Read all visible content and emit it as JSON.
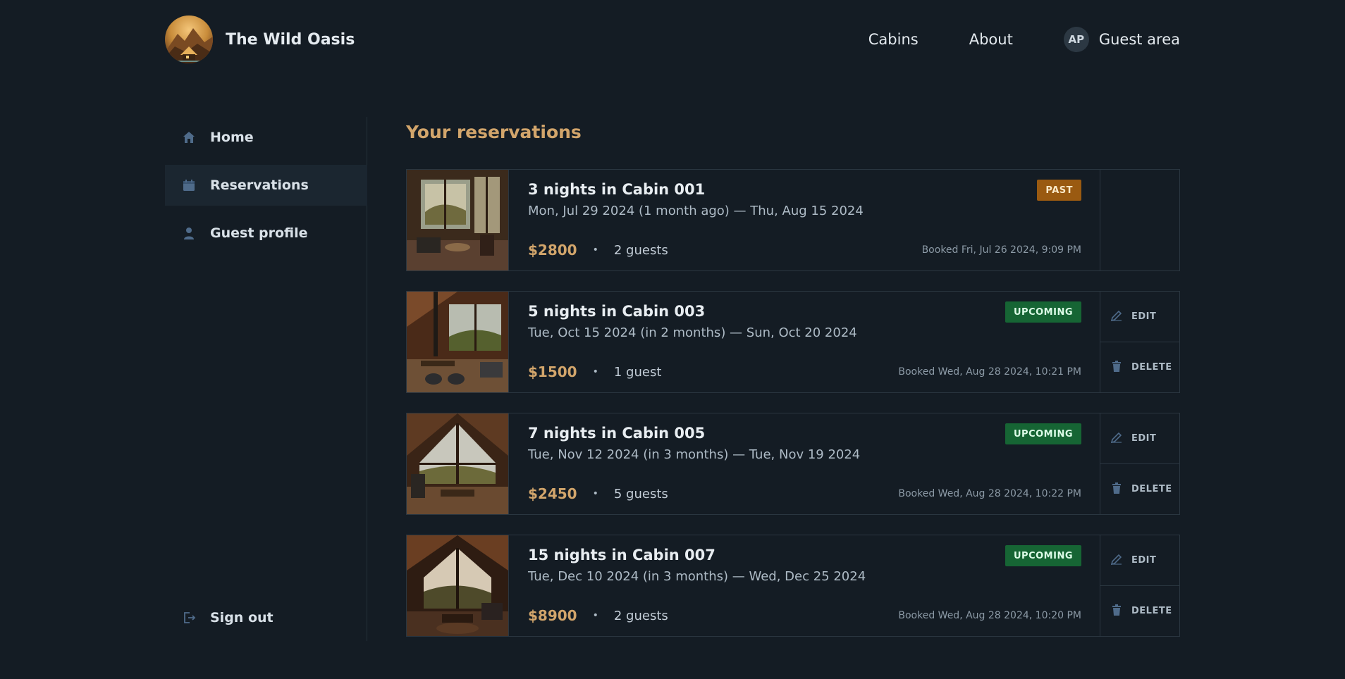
{
  "header": {
    "brand_name": "The Wild Oasis",
    "logo_icon": "mountain-cabin-logo",
    "nav": [
      {
        "label": "Cabins"
      },
      {
        "label": "About"
      }
    ],
    "guest_area": {
      "avatar_initials": "AP",
      "label": "Guest area"
    }
  },
  "sidebar": {
    "items": [
      {
        "label": "Home",
        "icon": "home-icon",
        "active": false
      },
      {
        "label": "Reservations",
        "icon": "calendar-icon",
        "active": true
      },
      {
        "label": "Guest profile",
        "icon": "user-icon",
        "active": false
      }
    ],
    "signout": {
      "label": "Sign out",
      "icon": "sign-out-icon"
    }
  },
  "main": {
    "title": "Your reservations",
    "reservations": [
      {
        "title": "3 nights in Cabin 001",
        "dates": "Mon, Jul 29 2024 (1 month ago) — Thu, Aug 15 2024",
        "price": "$2800",
        "guests": "2 guests",
        "booked": "Booked Fri, Jul 26 2024, 9:09 PM",
        "status": "PAST",
        "actions": []
      },
      {
        "title": "5 nights in Cabin 003",
        "dates": "Tue, Oct 15 2024 (in 2 months) — Sun, Oct 20 2024",
        "price": "$1500",
        "guests": "1 guest",
        "booked": "Booked Wed, Aug 28 2024, 10:21 PM",
        "status": "UPCOMING",
        "actions": [
          "EDIT",
          "DELETE"
        ]
      },
      {
        "title": "7 nights in Cabin 005",
        "dates": "Tue, Nov 12 2024 (in 3 months) — Tue, Nov 19 2024",
        "price": "$2450",
        "guests": "5 guests",
        "booked": "Booked Wed, Aug 28 2024, 10:22 PM",
        "status": "UPCOMING",
        "actions": [
          "EDIT",
          "DELETE"
        ]
      },
      {
        "title": "15 nights in Cabin 007",
        "dates": "Tue, Dec 10 2024 (in 3 months) — Wed, Dec 25 2024",
        "price": "$8900",
        "guests": "2 guests",
        "booked": "Booked Wed, Aug 28 2024, 10:20 PM",
        "status": "UPCOMING",
        "actions": [
          "EDIT",
          "DELETE"
        ]
      }
    ]
  },
  "colors": {
    "background": "#141c24",
    "accent": "#d2a56b",
    "past_badge": "#9a5a11",
    "upcoming_badge": "#166534"
  }
}
